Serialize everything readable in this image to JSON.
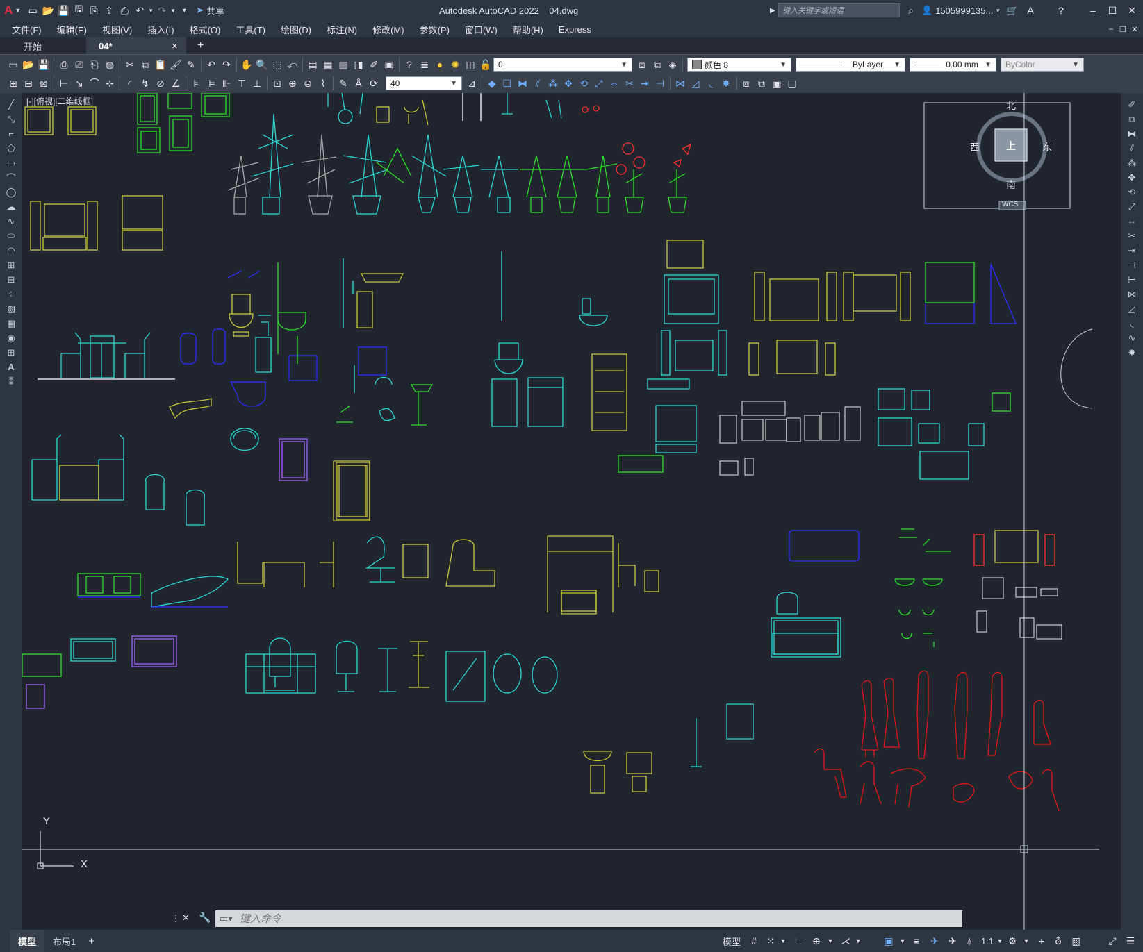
{
  "titlebar": {
    "app_letter": "A",
    "share_label": "共享",
    "title": "Autodesk AutoCAD 2022    04.dwg",
    "search_placeholder": "键入关键字或短语",
    "user": "1505999135...",
    "accent_color": "#c8102e"
  },
  "menu": [
    "文件(F)",
    "编辑(E)",
    "视图(V)",
    "插入(I)",
    "格式(O)",
    "工具(T)",
    "绘图(D)",
    "标注(N)",
    "修改(M)",
    "参数(P)",
    "窗口(W)",
    "帮助(H)",
    "Express"
  ],
  "tabs": [
    {
      "label": "开始"
    },
    {
      "label": "04*",
      "close": "✕"
    }
  ],
  "new_tab": "+",
  "toolbar": {
    "layer_value": "0",
    "color_value": "颜色 8",
    "linetype_value": "ByLayer",
    "lineweight_value": "0.00 mm",
    "plotstyle_value": "ByColor",
    "dim_scale_value": "40"
  },
  "viewport": {
    "label": "[-][俯视][二维线框]",
    "viewcube": {
      "north": "北",
      "south": "南",
      "east": "东",
      "west": "西",
      "top": "上",
      "wcs": "WCS"
    },
    "ucs": {
      "x": "X",
      "y": "Y"
    }
  },
  "command": {
    "placeholder": "键入命令"
  },
  "status": {
    "tabs": [
      "模型",
      "布局1"
    ],
    "add": "+",
    "model_label": "模型",
    "scale": "1:1"
  }
}
